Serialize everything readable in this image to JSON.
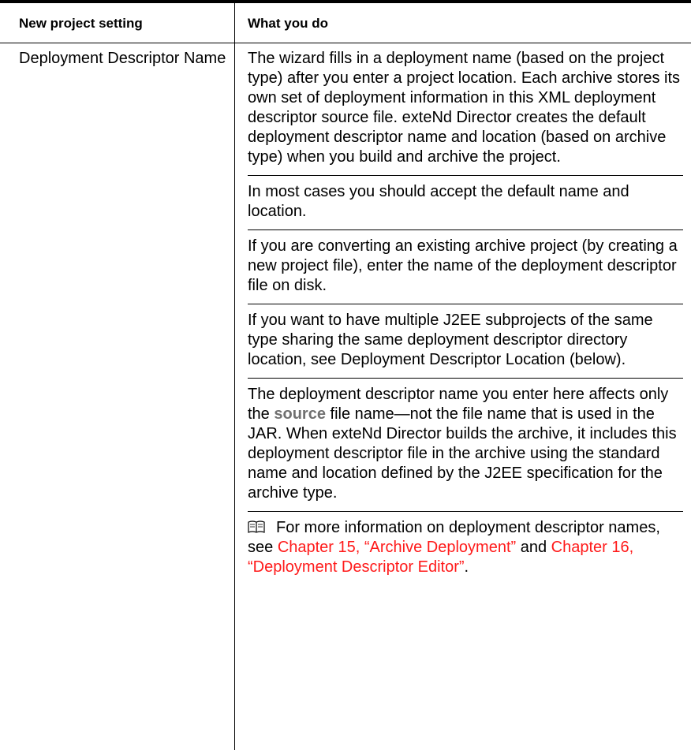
{
  "table": {
    "headers": {
      "setting": "New project setting",
      "action": "What you do"
    },
    "row": {
      "setting": "Deployment Descriptor Name",
      "p1": "The wizard fills in a deployment name (based on the project type) after you enter a project location. Each archive stores its own set of deployment information in this XML deployment descriptor source file. exteNd Director creates the default deployment descriptor name and location (based on archive type) when you build and archive the project.",
      "p2": "In most cases you should accept the default name and location.",
      "p3": "If you are converting an existing archive project (by creating a new project file), enter the name of the deployment descriptor file on disk.",
      "p4": "If you want to have multiple J2EE subprojects of the same type sharing the same deployment descriptor directory location, see Deployment Descriptor Location (below).",
      "p5_before": "The deployment descriptor name you enter here affects only the",
      "p5_emph": "source",
      "p5_after": "file name—not the file name that is used in the JAR. When exteNd Director builds the archive, it includes this deployment descriptor file in the archive using the standard name and location defined by the J2EE specification for the archive type.",
      "note_before": "For more information on deployment descriptor names, see",
      "note_link1": "Chapter 15, “Archive Deployment”",
      "note_mid": "and",
      "note_link2": "Chapter 16, “Deployment Descriptor Editor”",
      "note_after": "."
    }
  },
  "colors": {
    "link": "#ff1a1a",
    "emphasis": "#707070",
    "rule": "#000000"
  },
  "icons": {
    "note": "book-icon"
  }
}
